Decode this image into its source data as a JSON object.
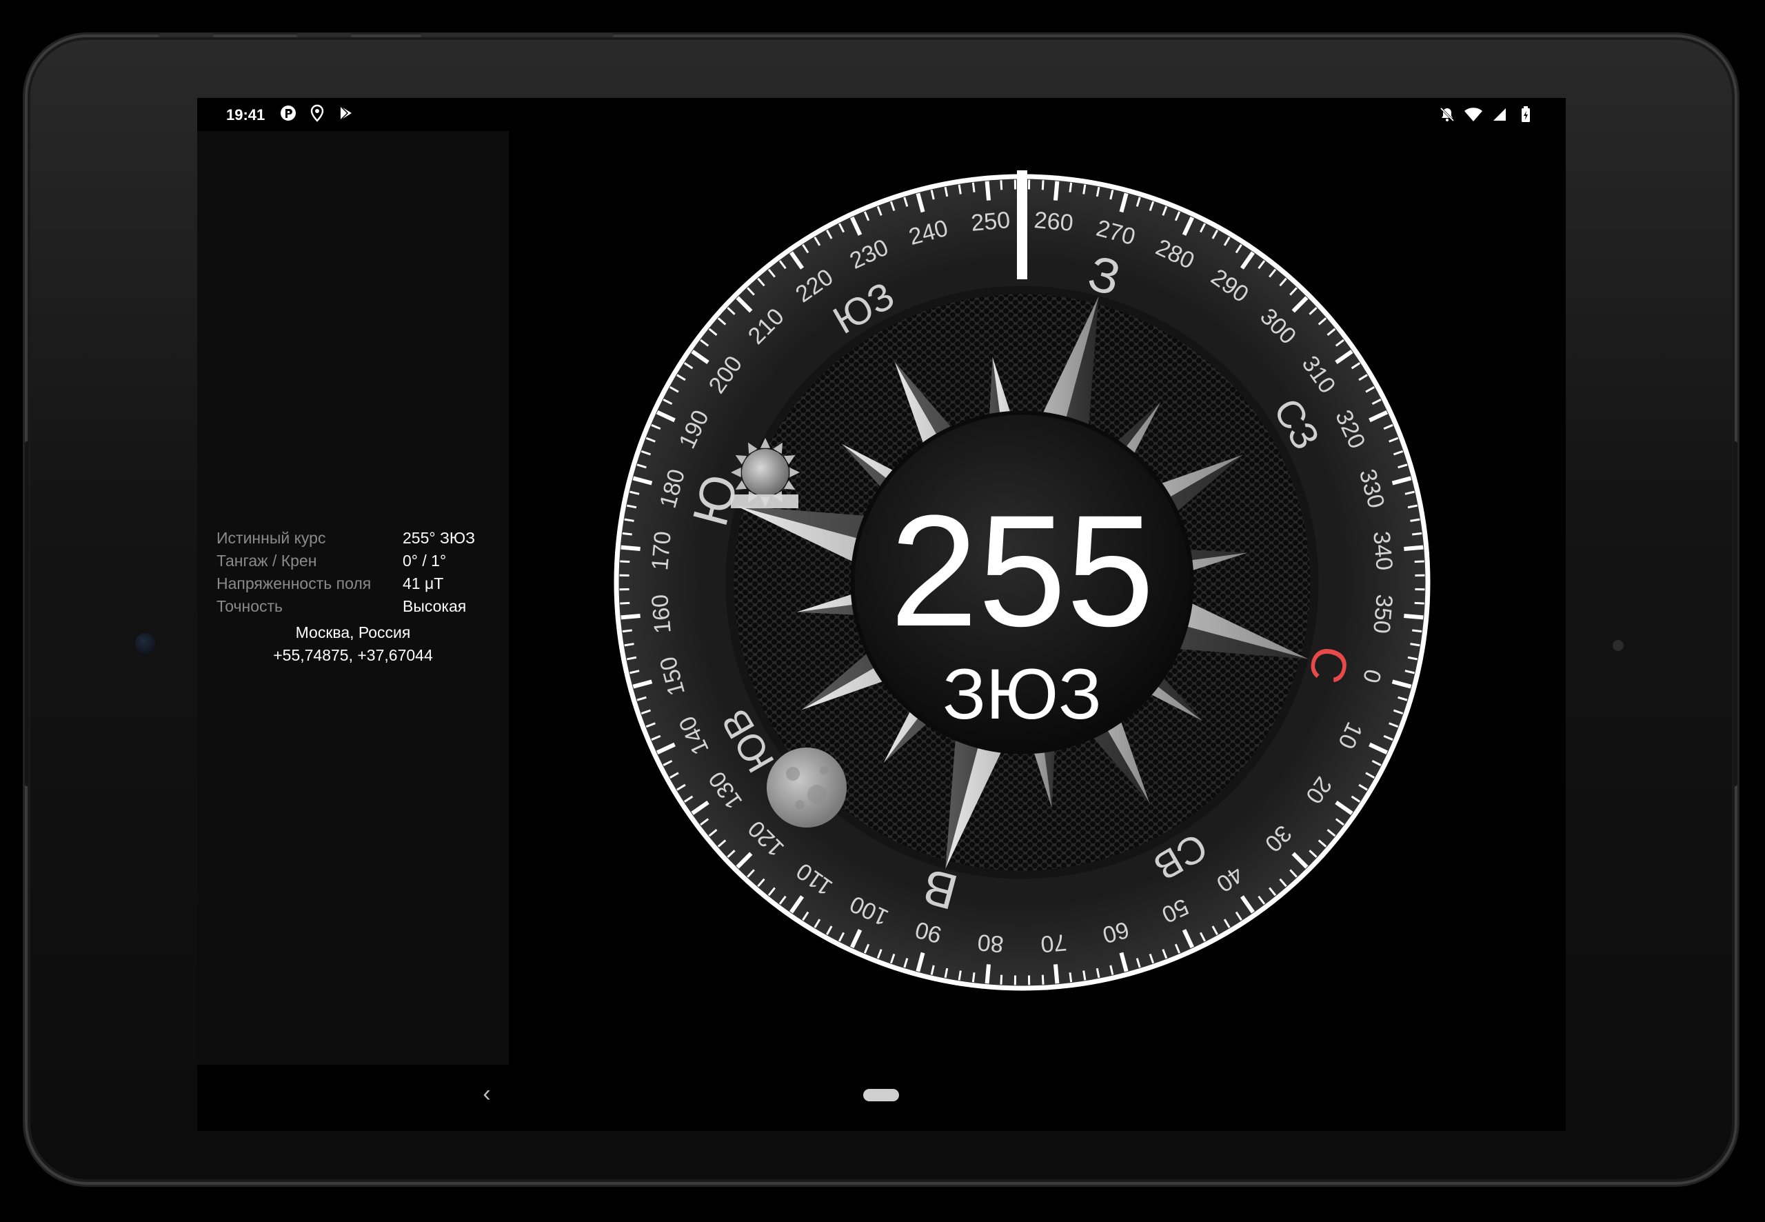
{
  "status_bar": {
    "time": "19:41",
    "left_icons": [
      "app-notification-icon",
      "location-icon",
      "play-store-icon"
    ],
    "right_icons": [
      "alarm-off-icon",
      "wifi-icon",
      "cellular-signal-icon",
      "battery-icon"
    ]
  },
  "info_panel": {
    "rows": [
      {
        "label": "Истинный курс",
        "value": "255° ЗЮЗ"
      },
      {
        "label": "Тангаж / Крен",
        "value": "0° / 1°"
      },
      {
        "label": "Напряженность поля",
        "value": "41 μT"
      },
      {
        "label": "Точность",
        "value": "Высокая"
      }
    ],
    "location_name": "Москва, Россия",
    "location_coords": "+55,74875, +37,67044"
  },
  "compass": {
    "heading_value": "255",
    "heading_direction": "ЗЮЗ",
    "heading": 255,
    "cardinals": [
      {
        "label": "С",
        "angle": 0,
        "color": "#e84a4a"
      },
      {
        "label": "СВ",
        "angle": 45,
        "color": "#cfcfcf"
      },
      {
        "label": "В",
        "angle": 90,
        "color": "#cfcfcf"
      },
      {
        "label": "ЮВ",
        "angle": 135,
        "color": "#cfcfcf"
      },
      {
        "label": "Ю",
        "angle": 180,
        "color": "#cfcfcf"
      },
      {
        "label": "ЮЗ",
        "angle": 225,
        "color": "#cfcfcf"
      },
      {
        "label": "З",
        "angle": 270,
        "color": "#cfcfcf"
      },
      {
        "label": "СЗ",
        "angle": 315,
        "color": "#cfcfcf"
      }
    ],
    "degree_labels": [
      "0",
      "10",
      "20",
      "30",
      "40",
      "50",
      "60",
      "70",
      "80",
      "90",
      "100",
      "110",
      "120",
      "130",
      "140",
      "150",
      "160",
      "170",
      "180",
      "190",
      "200",
      "210",
      "220",
      "230",
      "240",
      "250",
      "260",
      "270",
      "280",
      "290",
      "300",
      "310",
      "320",
      "330",
      "340",
      "350"
    ],
    "sun_icon": "sun-icon",
    "moon_icon": "moon-icon"
  },
  "nav_bar": {
    "back_glyph": "‹",
    "icons": [
      "back-icon",
      "home-pill-icon"
    ]
  }
}
